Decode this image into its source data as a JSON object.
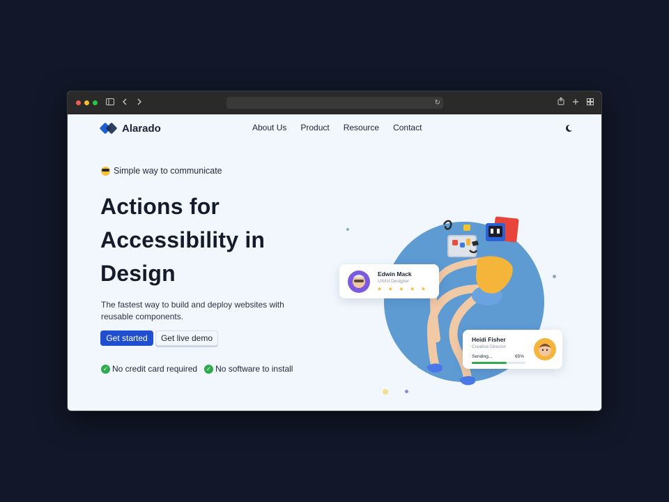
{
  "browser": {
    "url": "",
    "icons": {
      "sidebar": "sidebar-icon",
      "back": "chevron-left-icon",
      "forward": "chevron-right-icon",
      "reload": "reload-icon",
      "share": "share-icon",
      "new_tab": "plus-icon",
      "tabs": "tab-overview-icon"
    }
  },
  "brand": {
    "name": "Alarado",
    "colors": {
      "primary": "#1f4ed1",
      "dark": "#141c2c",
      "accent_green": "#2faa4d",
      "circle_blue": "#5e9bd3"
    }
  },
  "nav": {
    "items": [
      "About Us",
      "Product",
      "Resource",
      "Contact"
    ],
    "theme_toggle_icon": "moon-icon"
  },
  "hero": {
    "eyebrow": "Simple way to communicate",
    "eyebrow_icon": "sunglasses-emoji-icon",
    "headline_lines": [
      "Actions for",
      "Accessibility in",
      "Design"
    ],
    "description": "The fastest way to build and deploy websites with reusable components.",
    "primary_cta": "Get started",
    "secondary_cta": "Get live demo",
    "features": [
      "No credit card required",
      "No software to install"
    ]
  },
  "cards": {
    "profile": {
      "name": "Edwin Mack",
      "role": "UX/UI Designer",
      "stars": "★ ★ ★ ★ ★",
      "rating": 5
    },
    "sending": {
      "name": "Heidi Fisher",
      "role": "Creative Director",
      "status": "Sending...",
      "percent_label": "65%",
      "percent": 65
    }
  }
}
